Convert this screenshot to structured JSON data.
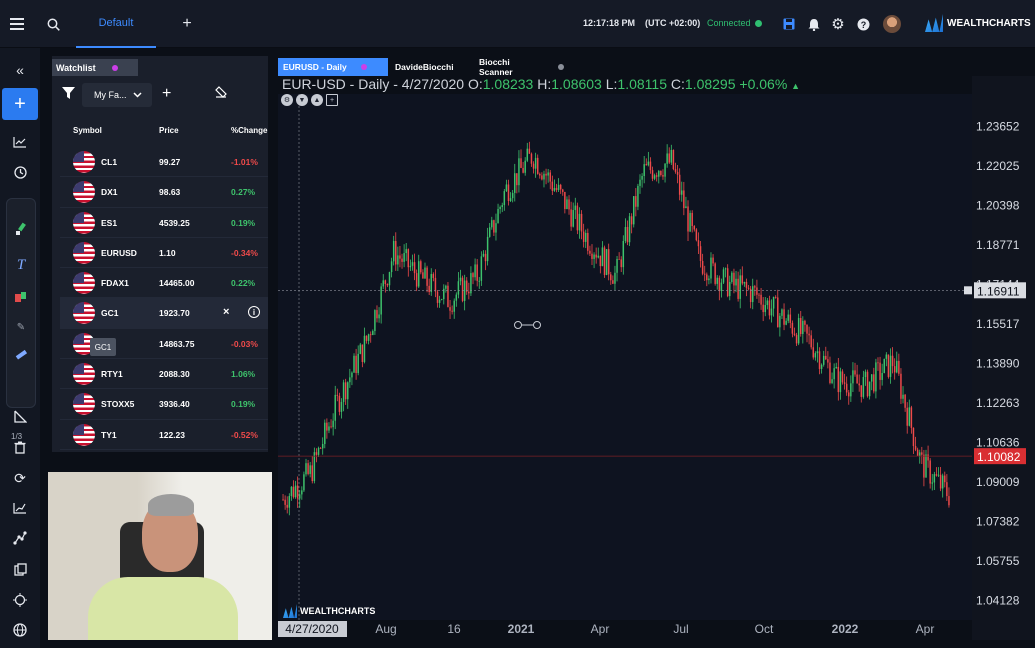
{
  "topbar": {
    "tab_label": "Default",
    "time": "12:17:18 PM",
    "timezone": "(UTC +02:00)",
    "connection_status": "Connected",
    "brand": "WEALTHCHARTS",
    "icons": [
      "menu-icon",
      "search-icon",
      "add-tab-icon",
      "save-icon",
      "bell-icon",
      "gear-icon",
      "help-icon"
    ],
    "connection_color": "#2fbf71",
    "accent_color": "#3d8bff"
  },
  "lefttools": {
    "page_count": "1/3",
    "icons": [
      "collapse-icon",
      "plus-icon",
      "line-chart-icon",
      "clock-icon",
      "brush-icon",
      "text-icon",
      "pattern-icon",
      "tag-icon",
      "ruler-icon",
      "triangle-tool-icon",
      "trash-icon",
      "refresh-icon",
      "analysis-icon",
      "node-icon",
      "layers-icon",
      "crosshair-icon",
      "globe-icon"
    ]
  },
  "watchlist": {
    "tab_label": "Watchlist",
    "list_name": "My Fa...",
    "columns": {
      "symbol": "Symbol",
      "price": "Price",
      "change": "%Change"
    },
    "rows": [
      {
        "symbol": "CL1",
        "price": "99.27",
        "change": "-1.01%",
        "dir": "down"
      },
      {
        "symbol": "DX1",
        "price": "98.63",
        "change": "0.27%",
        "dir": "up"
      },
      {
        "symbol": "ES1",
        "price": "4539.25",
        "change": "0.19%",
        "dir": "up"
      },
      {
        "symbol": "EURUSD",
        "price": "1.10",
        "change": "-0.34%",
        "dir": "down"
      },
      {
        "symbol": "FDAX1",
        "price": "14465.00",
        "change": "0.22%",
        "dir": "up"
      },
      {
        "symbol": "GC1",
        "price": "1923.70",
        "change": "",
        "dir": "sel"
      },
      {
        "symbol": "",
        "price": "14863.75",
        "change": "-0.03%",
        "dir": "down"
      },
      {
        "symbol": "RTY1",
        "price": "2088.30",
        "change": "1.06%",
        "dir": "up"
      },
      {
        "symbol": "STOXX5",
        "price": "3936.40",
        "change": "0.19%",
        "dir": "up"
      },
      {
        "symbol": "TY1",
        "price": "122.23",
        "change": "-0.52%",
        "dir": "down"
      }
    ],
    "tooltip": "GC1",
    "row_close": "×",
    "row_info": "i",
    "up_color": "#3ec36c",
    "down_color": "#ef4a4a"
  },
  "chart_tabs": [
    {
      "label": "EURUSD - Daily"
    },
    {
      "label": "DavideBiocchi"
    },
    {
      "label": "Biocchi Scanner"
    }
  ],
  "legend": {
    "title": "EUR-USD - Daily - 4/27/2020",
    "o_label": "O:",
    "o": "1.08233",
    "h_label": "H:",
    "h": "1.08603",
    "l_label": "L:",
    "l": "1.08115",
    "c_label": "C:",
    "c": "1.08295",
    "change": "+0.06%"
  },
  "watermark": "WEALTHCHARTS",
  "chart_data": {
    "type": "line",
    "title": "EUR-USD - Daily - 4/27/2020",
    "xlabel": "",
    "ylabel": "",
    "x_ticks": [
      "4/27/2020",
      "Aug",
      "16",
      "2021",
      "Apr",
      "Jul",
      "Oct",
      "2022",
      "Apr"
    ],
    "y_ticks": [
      "1.23652",
      "1.22025",
      "1.20398",
      "1.18771",
      "1.17144",
      "1.15517",
      "1.13890",
      "1.12263",
      "1.10636",
      "1.09009",
      "1.07382",
      "1.05755",
      "1.04128"
    ],
    "ylim": [
      1.035,
      1.245
    ],
    "crosshair_price": "1.16911",
    "last_price": "1.10082",
    "x": [
      "2020-04",
      "2020-05",
      "2020-06",
      "2020-07",
      "2020-08",
      "2020-09",
      "2020-10",
      "2020-11",
      "2020-12",
      "2021-01",
      "2021-02",
      "2021-03",
      "2021-04",
      "2021-05",
      "2021-06",
      "2021-07",
      "2021-08",
      "2021-09",
      "2021-10",
      "2021-11",
      "2021-12",
      "2022-01",
      "2022-02",
      "2022-03",
      "2022-04"
    ],
    "series": [
      {
        "values": [
          1.083,
          1.094,
          1.124,
          1.148,
          1.185,
          1.174,
          1.165,
          1.175,
          1.21,
          1.225,
          1.208,
          1.19,
          1.175,
          1.218,
          1.222,
          1.182,
          1.172,
          1.168,
          1.158,
          1.148,
          1.132,
          1.13,
          1.14,
          1.098,
          1.085
        ]
      }
    ],
    "grid": false,
    "up_color": "#3ec36c",
    "down_color": "#ef4a4a"
  }
}
